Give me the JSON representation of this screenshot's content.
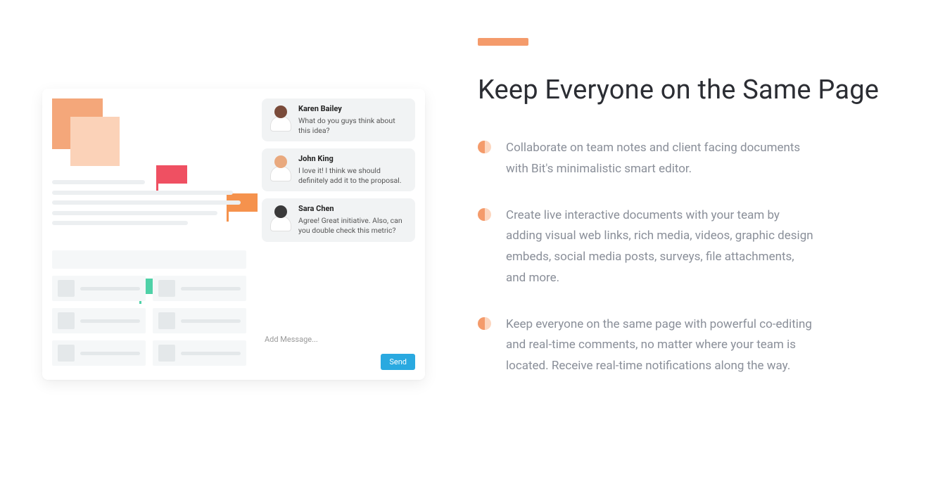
{
  "content": {
    "title": "Keep Everyone on the Same Page",
    "benefits": [
      "Collaborate on team notes and client facing documents with Bit's minimalistic smart editor.",
      "Create live interactive documents with your team by adding visual web links, rich media, videos, graphic design embeds, social media posts, surveys, file attachments, and more.",
      "Keep everyone on the same page with powerful co-editing and real-time comments, no matter where your team is located. Receive real-time notifications along the way."
    ]
  },
  "chat": {
    "messages": [
      {
        "name": "Karen Bailey",
        "text": "What do you guys think about this idea?"
      },
      {
        "name": "John King",
        "text": "I love it! I think we should definitely add it to the proposal."
      },
      {
        "name": "Sara Chen",
        "text": "Agree! Great initiative. Also, can you double check this metric?"
      }
    ],
    "input_placeholder": "Add Message...",
    "send_label": "Send"
  }
}
